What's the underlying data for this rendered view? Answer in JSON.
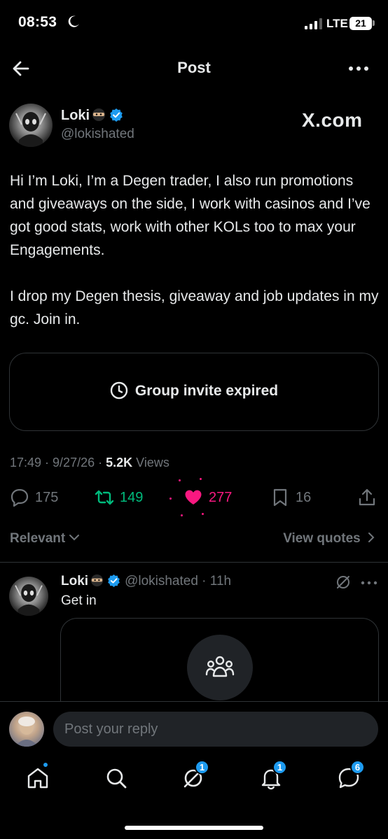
{
  "status_bar": {
    "time": "08:53",
    "network": "LTE",
    "battery": "21"
  },
  "header": {
    "title": "Post"
  },
  "post": {
    "author_name": "Loki",
    "author_handle": "@lokishated",
    "source_label": "X.com",
    "paragraphs": [
      "Hi I’m Loki, I’m a Degen trader, I also run promotions and giveaways on the side, I work with casinos and I’ve got good stats, work with other KOLs too to max your Engagements.",
      "I drop my Degen thesis, giveaway and job updates in my gc. Join in."
    ],
    "card_label": "Group invite expired",
    "time": "17:49",
    "date": "9/27/26",
    "views_count": "5.2K",
    "views_label": "Views",
    "replies": "175",
    "reposts": "149",
    "likes": "277",
    "bookmarks": "16"
  },
  "sort": {
    "relevant_label": "Relevant",
    "view_quotes_label": "View quotes"
  },
  "reply": {
    "author_name": "Loki",
    "handle_time": "@lokishated · 11h",
    "text": "Get in"
  },
  "composer": {
    "placeholder": "Post your reply"
  },
  "nav": {
    "grok_badge": "1",
    "notifications_badge": "1",
    "messages_badge": "6"
  },
  "colors": {
    "background": "#000000",
    "text": "#e7e9ea",
    "muted": "#71767b",
    "accent": "#1d9bf0",
    "repost": "#00ba7c",
    "like": "#f91880"
  }
}
